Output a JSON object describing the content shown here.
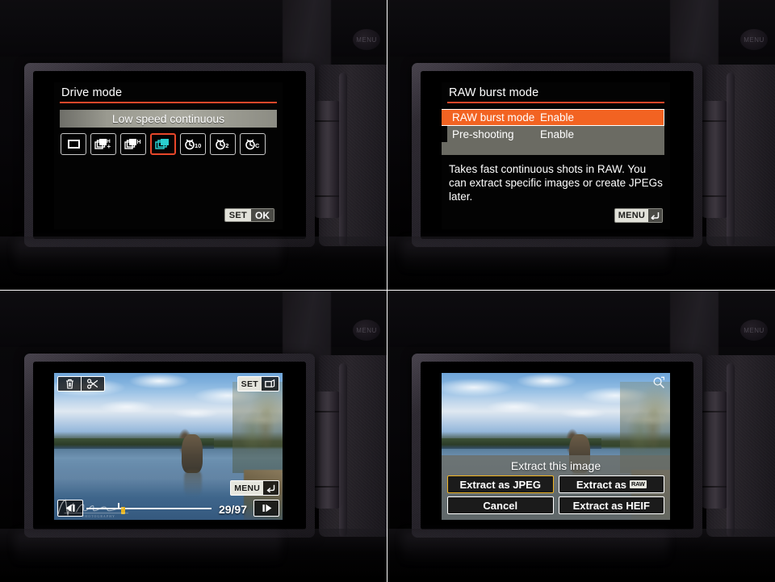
{
  "camera": {
    "menu_button_label": "MENU"
  },
  "panels": {
    "drive_mode": {
      "title": "Drive mode",
      "selected_label": "Low speed continuous",
      "icons": [
        {
          "name": "single-shooting-icon",
          "label": "Single shooting"
        },
        {
          "name": "high-speed-continuous-plus-icon",
          "label": "H+"
        },
        {
          "name": "high-speed-continuous-icon",
          "label": "H"
        },
        {
          "name": "low-speed-continuous-icon",
          "label": "Low speed continuous",
          "selected": true
        },
        {
          "name": "self-timer-10s-icon",
          "label": "10"
        },
        {
          "name": "self-timer-2s-icon",
          "label": "2"
        },
        {
          "name": "self-timer-continuous-icon",
          "label": "C"
        }
      ],
      "set_label": "SET",
      "ok_label": "OK"
    },
    "raw_burst_mode": {
      "title": "RAW burst mode",
      "rows": [
        {
          "label": "RAW burst mode",
          "value": "Enable",
          "highlighted": true
        },
        {
          "label": "Pre-shooting",
          "value": "Enable",
          "highlighted": false
        }
      ],
      "description": "Takes fast continuous shots in RAW. You can extract specific images or create JPEGs later.",
      "menu_label": "MENU",
      "back_arrow": "↰"
    },
    "roll_playback": {
      "delete_icon": "trash-icon",
      "trim_icon": "scissors-icon",
      "set_label": "SET",
      "set_icon": "extract-frame-icon",
      "menu_label": "MENU",
      "menu_arrow": "↰",
      "prev_label": "◀❙",
      "next_label": "❙▶",
      "frame_counter": "29/97"
    },
    "extract_dialog": {
      "magnify_icon": "magnify-icon",
      "title": "Extract this image",
      "buttons": [
        {
          "label": "Extract as JPEG",
          "active": true
        },
        {
          "label": "Extract as ",
          "badge": "RAW",
          "active": false
        },
        {
          "label": "Cancel",
          "active": false
        },
        {
          "label": "Extract as HEIF",
          "active": false
        }
      ]
    }
  },
  "colors": {
    "accent_orange": "#e8472a",
    "highlight_orange": "#f26322",
    "selected_yellow": "#f0b422",
    "cyan_icon": "#2ad0d0",
    "bar_grey": "#aaaaa0"
  }
}
